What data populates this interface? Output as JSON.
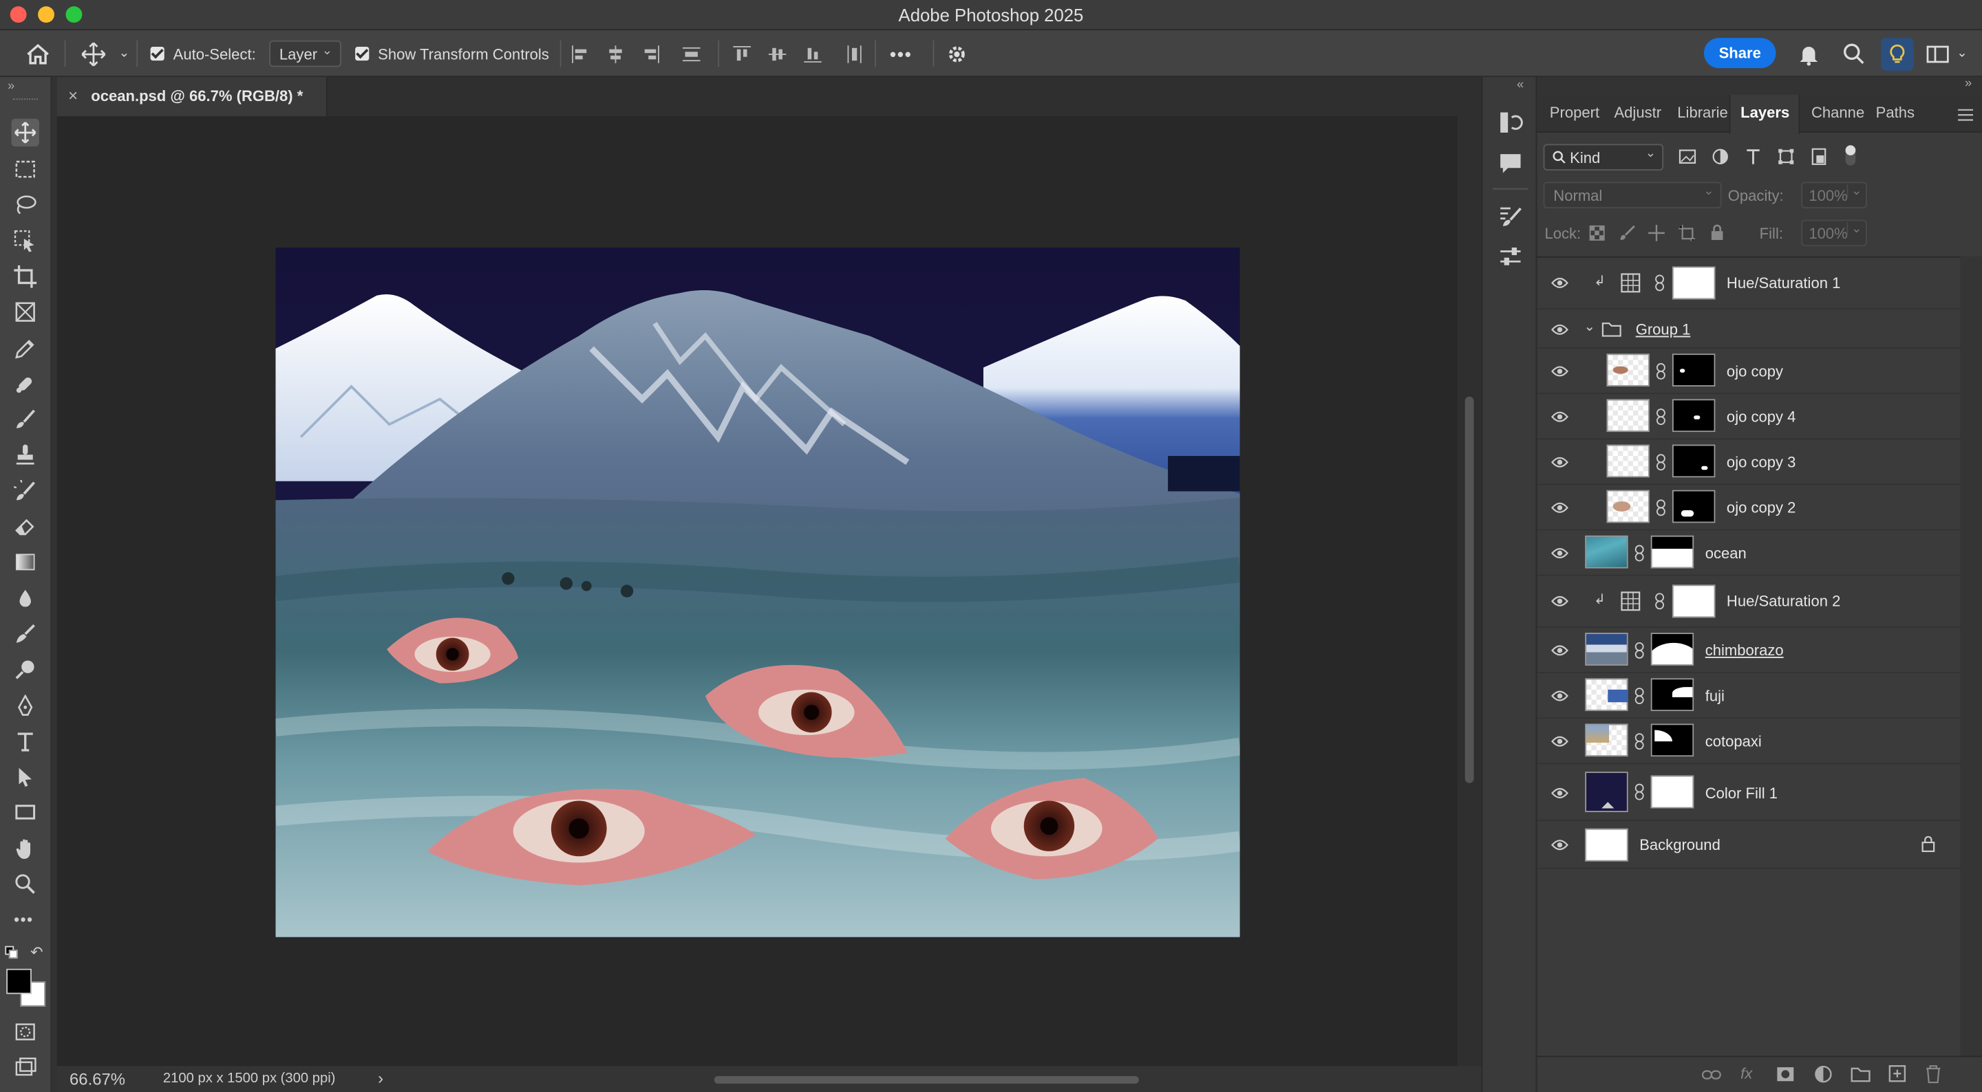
{
  "window": {
    "title": "Adobe Photoshop 2025"
  },
  "options_bar": {
    "auto_select_label": "Auto-Select:",
    "auto_select_value": "Layer",
    "transform_label": "Show Transform Controls",
    "more": "•••",
    "share_label": "Share"
  },
  "document": {
    "tab_title": "ocean.psd @ 66.7% (RGB/8) *",
    "close_glyph": "×",
    "zoom": "66.67%",
    "size_info": "2100 px x 1500 px (300 ppi)",
    "status_arrow": "›"
  },
  "panel": {
    "tabs": [
      "Propert",
      "Adjustr",
      "Librarie",
      "Layers",
      "Channe",
      "Paths"
    ],
    "active_tab": "Layers",
    "filter_kind": "Kind",
    "blend_mode": "Normal",
    "opacity_label": "Opacity:",
    "opacity_value": "100%",
    "lock_label": "Lock:",
    "fill_label": "Fill:",
    "fill_value": "100%",
    "layers": [
      {
        "name": "Hue/Saturation 1",
        "kind": "adjustment",
        "clipped": true
      },
      {
        "name": "Group 1",
        "kind": "group",
        "expanded": true
      },
      {
        "name": "ojo copy",
        "kind": "pixel-masked",
        "indented": true
      },
      {
        "name": "ojo copy 4",
        "kind": "pixel-masked",
        "indented": true
      },
      {
        "name": "ojo copy 3",
        "kind": "pixel-masked",
        "indented": true
      },
      {
        "name": "ojo copy 2",
        "kind": "pixel-masked",
        "indented": true
      },
      {
        "name": "ocean",
        "kind": "pixel-masked"
      },
      {
        "name": "Hue/Saturation 2",
        "kind": "adjustment",
        "clipped": true
      },
      {
        "name": "chimborazo",
        "kind": "pixel-masked",
        "underlined": true
      },
      {
        "name": "fuji",
        "kind": "pixel-masked"
      },
      {
        "name": "cotopaxi",
        "kind": "pixel-masked"
      },
      {
        "name": "Color Fill 1",
        "kind": "fill"
      },
      {
        "name": "Background",
        "kind": "background",
        "locked": true
      }
    ]
  },
  "colors": {
    "accent": "#1473e6",
    "fill_layer_color": "#1a1740"
  }
}
